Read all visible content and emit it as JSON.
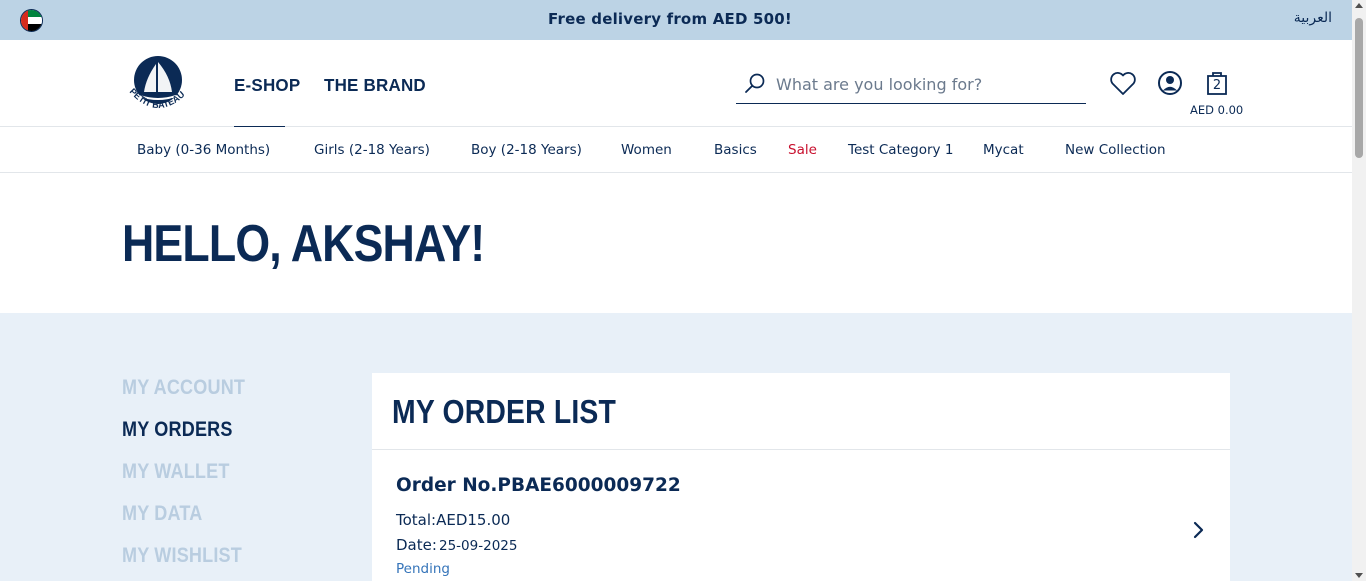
{
  "topbar": {
    "promo": "Free delivery from AED 500!",
    "language_link": "العربية",
    "flag_icon": "uae-flag-icon"
  },
  "header": {
    "logo_text": "PETIT BATEAU",
    "nav": [
      {
        "label": "E-SHOP",
        "active": true
      },
      {
        "label": "THE BRAND",
        "active": false
      }
    ],
    "search": {
      "placeholder": "What are you looking for?",
      "value": ""
    },
    "icons": [
      "search-icon",
      "heart-icon",
      "user-icon",
      "bag-icon"
    ],
    "cart": {
      "count": "2",
      "total": "AED 0.00"
    }
  },
  "categories": [
    {
      "label": "Baby (0-36 Months)"
    },
    {
      "label": "Girls (2-18 Years)"
    },
    {
      "label": "Boy (2-18 Years)"
    },
    {
      "label": "Women"
    },
    {
      "label": "Basics"
    },
    {
      "label": "Sale",
      "highlight": "#c8102e"
    },
    {
      "label": "Test Category 1"
    },
    {
      "label": "Mycat"
    },
    {
      "label": "New Collection"
    }
  ],
  "greeting": "HELLO, AKSHAY!",
  "sidebar": {
    "items": [
      {
        "label": "MY ACCOUNT",
        "active": false
      },
      {
        "label": "MY ORDERS",
        "active": true
      },
      {
        "label": "MY WALLET",
        "active": false
      },
      {
        "label": "MY DATA",
        "active": false
      },
      {
        "label": "MY WISHLIST",
        "active": false
      }
    ]
  },
  "orders": {
    "title": "MY ORDER LIST",
    "list": [
      {
        "order_no": "Order No.PBAE6000009722",
        "total": "Total:AED15.00",
        "date_label": "Date:",
        "date": "25-09-2025",
        "status": "Pending"
      }
    ]
  },
  "colors": {
    "primary": "#0b2a55",
    "topbar_bg": "#bcd3e5",
    "account_bg": "#e8f0f8",
    "inactive_sidebar": "#b9cde0",
    "sale": "#c8102e",
    "status": "#3574b9"
  }
}
